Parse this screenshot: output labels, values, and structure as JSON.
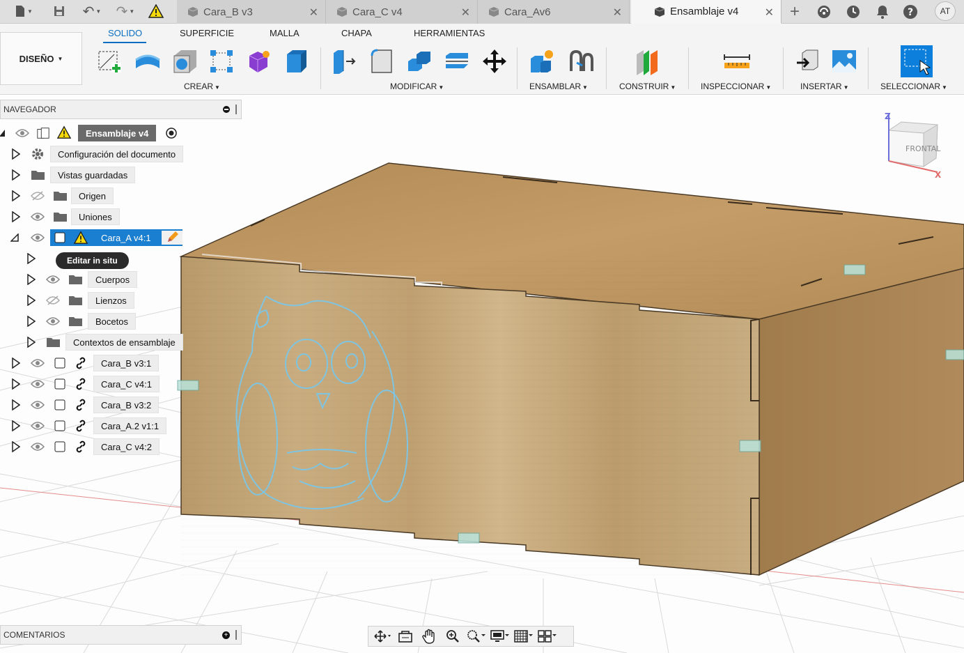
{
  "titlebar": {
    "tabs": [
      {
        "label": "Cara_B v3",
        "active": false
      },
      {
        "label": "Cara_C v4",
        "active": false
      },
      {
        "label": "Cara_Av6",
        "active": false
      },
      {
        "label": "Ensamblaje v4",
        "active": true
      }
    ],
    "user_initials": "AT"
  },
  "ribbon": {
    "workspace": "DISEÑO",
    "tabs": [
      "SOLIDO",
      "SUPERFICIE",
      "MALLA",
      "CHAPA",
      "HERRAMIENTAS"
    ],
    "active_tab": "SOLIDO",
    "groups": {
      "crear": "CREAR",
      "modificar": "MODIFICAR",
      "ensamblar": "ENSAMBLAR",
      "construir": "CONSTRUIR",
      "inspeccionar": "INSPECCIONAR",
      "insertar": "INSERTAR",
      "seleccionar": "SELECCIONAR"
    }
  },
  "navigator": {
    "title": "NAVEGADOR",
    "root": "Ensamblaje v4",
    "items": {
      "config": "Configuración del documento",
      "vistas": "Vistas guardadas",
      "origen": "Origen",
      "uniones": "Uniones",
      "cara_a": "Cara_A v4:1",
      "cuerpos": "Cuerpos",
      "lienzos": "Lienzos",
      "bocetos": "Bocetos",
      "contextos": "Contextos de ensamblaje",
      "cara_b1": "Cara_B v3:1",
      "cara_c1": "Cara_C v4:1",
      "cara_b2": "Cara_B v3:2",
      "cara_a2": "Cara_A.2 v1:1",
      "cara_c2": "Cara_C v4:2"
    },
    "tooltip": "Editar in situ"
  },
  "viewcube": {
    "face": "FRONTAL",
    "axis_z": "Z",
    "axis_x": "X"
  },
  "comments": {
    "title": "COMENTARIOS"
  },
  "colors": {
    "accent": "#0a6fc2",
    "wood": "#c2a376",
    "selection": "#1a7fd0"
  }
}
